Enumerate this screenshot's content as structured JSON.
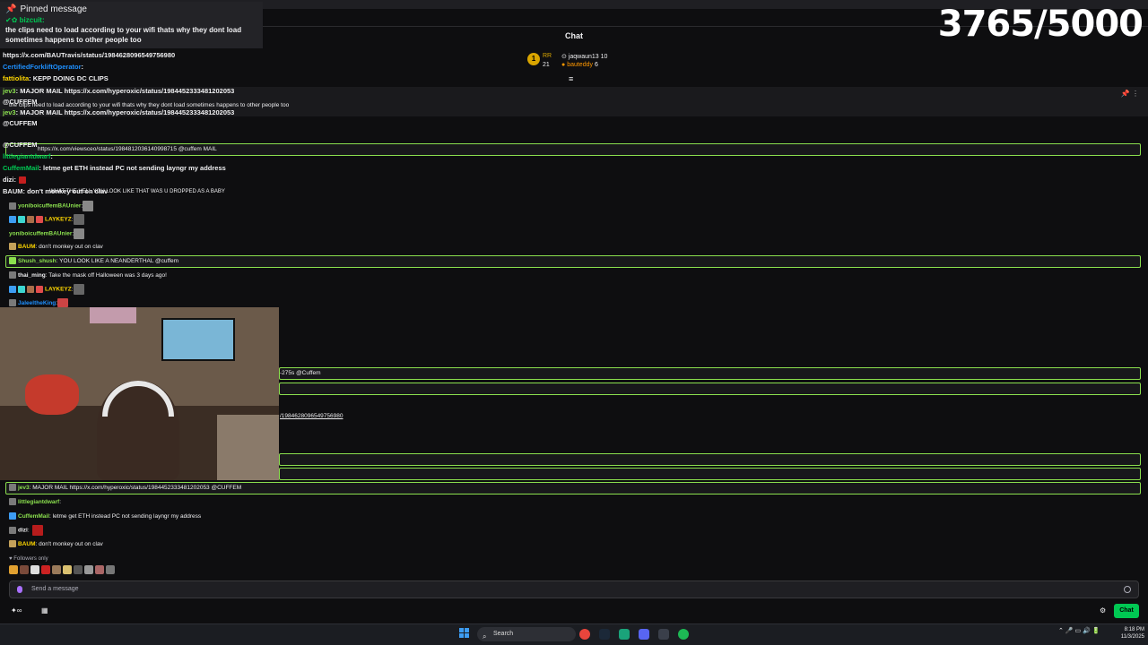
{
  "window": {
    "top_text": "... LX.AVAIIL.E.Y..LCJ8L-275s @CUFFEM"
  },
  "pinned": {
    "header": "Pinned message",
    "author": "bizcuit:",
    "text": "the clips need to load according to your wifi thats why they dont load sometimes happens to other people too"
  },
  "counter": "3765/5000",
  "chat_header": "Chat",
  "leaderboard": {
    "rank": "1",
    "rank_label": "RR",
    "rank_count": "21",
    "top1_name": "jaqwaun13",
    "top1_count": "10",
    "top2_name": "bauteddy",
    "top2_count": "6"
  },
  "overlay_lines": [
    {
      "text": "https://x.com/BAUTravis/status/1984628096549756980",
      "color": "#efeff1"
    },
    {
      "user": "CertifiedForkliftOperator",
      "text": ":",
      "color": "#1e90ff"
    },
    {
      "user": "fattiolita",
      "text": ": KEPP DOING DC CLIPS",
      "color": "#ffd700"
    },
    {
      "user": "jev3",
      "text": ": MAJOR MAIL https://x.com/hyperoxic/status/1984452333481202053",
      "color": "#8be04e"
    },
    {
      "user": "",
      "text": "@CUFFEM",
      "color": "#efeff1"
    },
    {
      "user": "jev3",
      "text": ": MAJOR MAIL https://x.com/hyperoxic/status/1984452333481202053",
      "color": "#8be04e"
    },
    {
      "user": "",
      "text": "@CUFFEM",
      "color": "#efeff1"
    },
    {
      "user": "",
      "text": "@CUFFEM",
      "color": "#efeff1"
    },
    {
      "user": "littlegiantdwarf",
      "text": ":",
      "color": "#00c853"
    },
    {
      "user": "CuffemMail",
      "text": ": letme get ETH instead PC not sending layngr my address",
      "color": "#00c853"
    },
    {
      "user": "dizi",
      "text": ":",
      "color": "#efeff1"
    },
    {
      "user": "BAUM",
      "text": ": don't monkey out on clav",
      "color": "#efeff1"
    }
  ],
  "pin2_text": "the clips need to load according to your wifi thats why they dont load sometimes happens to other people too",
  "messages": [
    {
      "user": "",
      "text": "https://x.com/viewsceo/status/1984812036140998715 @cuffem MAIL",
      "highlight": true
    },
    {
      "user": "",
      "text": "WHAT THE HELL YOU LOOK LIKE THAT WAS U DROPPED AS A BABY",
      "highlight": false
    },
    {
      "user": "yoniboicuffemBAUnier",
      "text": ":",
      "highlight": false
    },
    {
      "user": "LAYKEYZ",
      "text": ":",
      "highlight": false
    },
    {
      "user": "yoniboicuffemBAUnier",
      "text": ":",
      "highlight": false
    },
    {
      "user": "BAUM",
      "text": ": don't monkey out on clav",
      "highlight": false
    },
    {
      "user": "Shush_shush",
      "text": ": YOU LOOK LIKE A NEANDERTHAL @cuffem",
      "highlight": true
    },
    {
      "user": "thai_ming",
      "text": ": Take the mask off Halloween was 3 days ago!",
      "highlight": false
    },
    {
      "user": "LAYKEYZ",
      "text": ":",
      "highlight": false
    },
    {
      "user": "JaleeltheKing",
      "text": ":",
      "highlight": false
    },
    {
      "user": "",
      "text": "-275s @Cuffem",
      "highlight": true
    },
    {
      "user": "",
      "text": "",
      "highlight": true
    },
    {
      "user": "",
      "text": "/1984628096549756980",
      "highlight": false
    },
    {
      "user": "",
      "text": "",
      "highlight": true
    },
    {
      "user": "",
      "text": "",
      "highlight": true
    },
    {
      "user": "jev3",
      "text": ": MAJOR MAIL https://x.com/hyperoxic/status/1984452333481202053 @CUFFEM",
      "highlight": true
    },
    {
      "user": "littlegiantdwarf",
      "text": ":",
      "highlight": false
    },
    {
      "user": "CuffemMail",
      "text": ": letme get ETH instead PC not sending layngr my address",
      "highlight": false
    },
    {
      "user": "dizi",
      "text": ":",
      "highlight": false
    },
    {
      "user": "BAUM",
      "text": ": don't monkey out on clav",
      "highlight": false
    }
  ],
  "followers_only": "Followers only",
  "input_placeholder": "Send a message",
  "chat_button": "Chat",
  "taskbar": {
    "search_placeholder": "Search",
    "time": "8:18 PM",
    "date": "11/3/2025"
  }
}
